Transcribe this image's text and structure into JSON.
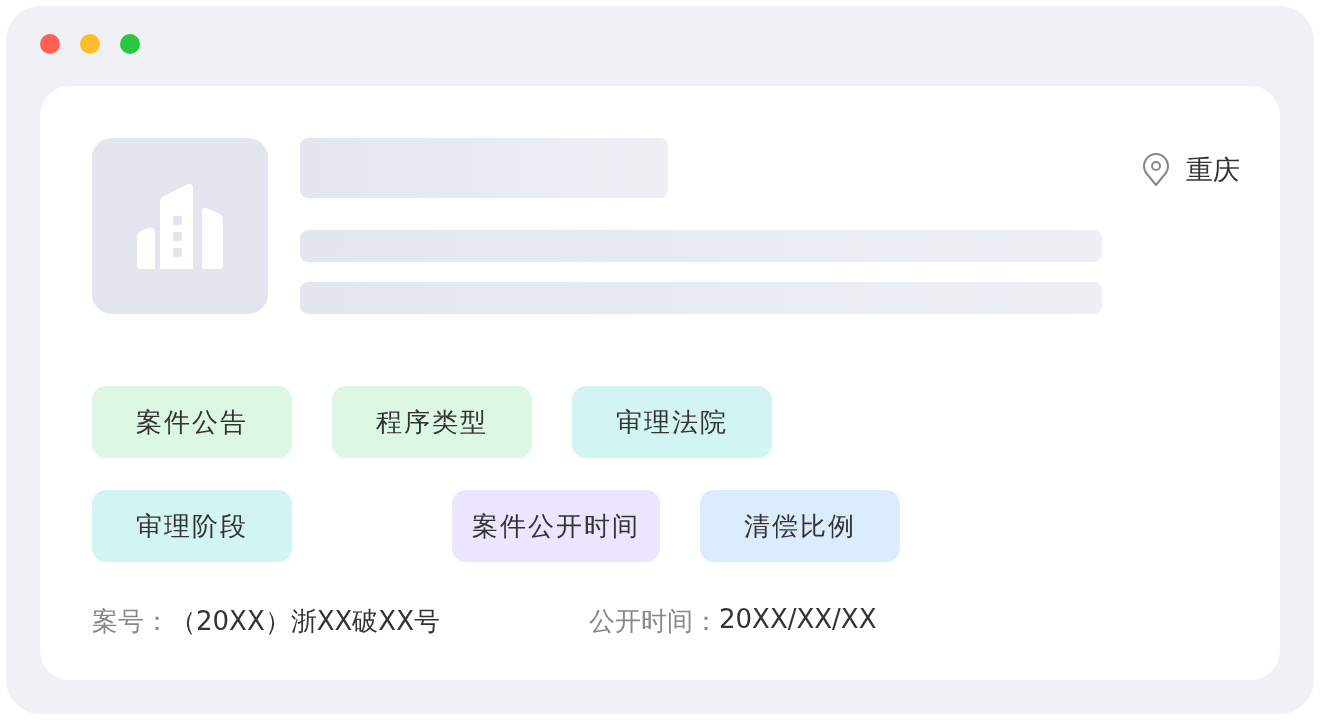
{
  "location": "重庆",
  "tags": [
    {
      "label": "案件公告",
      "color": "#dcf7e3"
    },
    {
      "label": "程序类型",
      "color": "#dcf7e3"
    },
    {
      "label": "审理法院",
      "color": "#d2f5f3"
    },
    {
      "label": "审理阶段",
      "color": "#d2f5f3"
    },
    {
      "label": "案件公开时间",
      "color": "#ebe6fd"
    },
    {
      "label": "清偿比例",
      "color": "#dbedfd"
    }
  ],
  "details": [
    {
      "label": "案号：",
      "value": "（20XX）浙XX破XX号"
    },
    {
      "label": "公开时间：",
      "value": "20XX/XX/XX"
    }
  ]
}
